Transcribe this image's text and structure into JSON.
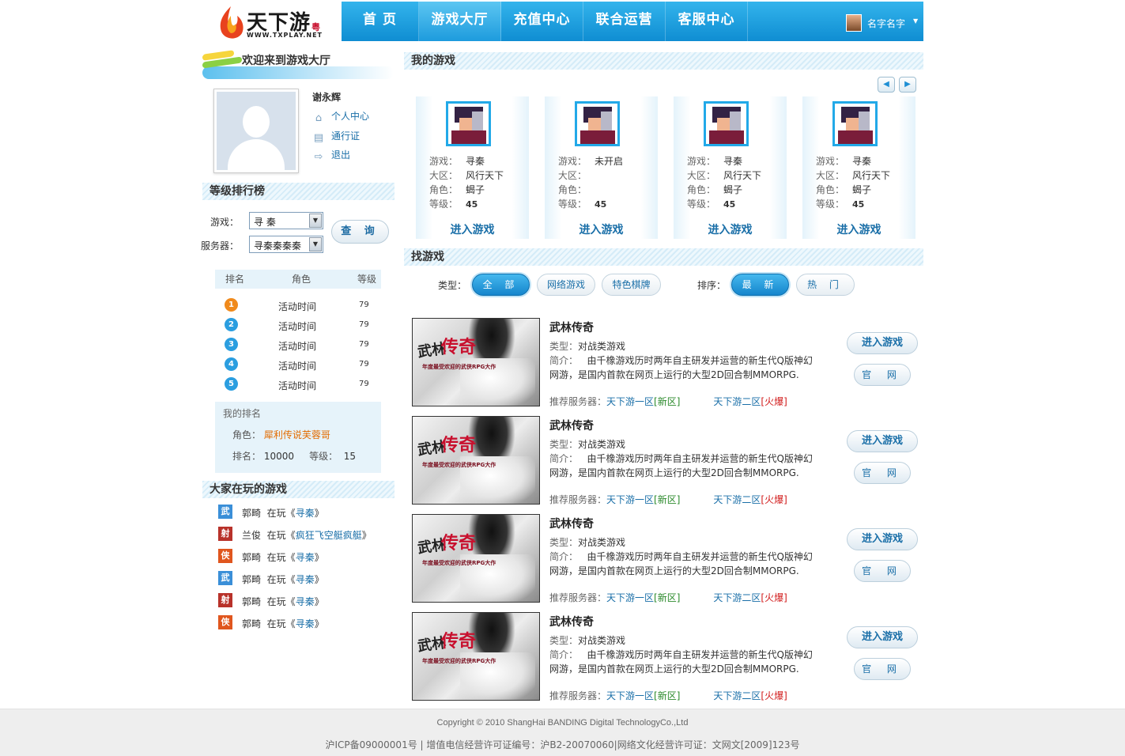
{
  "logo": {
    "text": "天下游",
    "sub": "WWW.TXPLAY.NET",
    "badge": "粤"
  },
  "nav": {
    "items": [
      {
        "label": "首 页"
      },
      {
        "label": "游戏大厅"
      },
      {
        "label": "充值中心"
      },
      {
        "label": "联合运营"
      },
      {
        "label": "客服中心"
      }
    ],
    "active_index": 1,
    "user_name": "名字名字"
  },
  "sidebar": {
    "welcome": "欢迎来到游戏大厅",
    "user": {
      "name": "谢永辉",
      "links": [
        {
          "label": "个人中心",
          "icon": "home-icon"
        },
        {
          "label": "通行证",
          "icon": "id-card-icon"
        },
        {
          "label": "退出",
          "icon": "logout-icon"
        }
      ]
    },
    "ranking": {
      "title": "等级排行榜",
      "game_label": "游戏：",
      "game_value": "寻 秦",
      "server_label": "服务器：",
      "server_value": "寻秦秦秦秦",
      "query_label": "查 询",
      "columns": [
        "排名",
        "角色",
        "等级"
      ],
      "rows": [
        {
          "rank": "1",
          "role": "活动时间",
          "level": "79"
        },
        {
          "rank": "2",
          "role": "活动时间",
          "level": "79"
        },
        {
          "rank": "3",
          "role": "活动时间",
          "level": "79"
        },
        {
          "rank": "4",
          "role": "活动时间",
          "level": "79"
        },
        {
          "rank": "5",
          "role": "活动时间",
          "level": "79"
        }
      ],
      "my_rank": {
        "title": "我的排名",
        "role_label": "角色：",
        "role_value": "犀利传说芙蓉哥",
        "rank_label": "排名：",
        "rank_value": "10000",
        "level_label": "等级：",
        "level_value": "15"
      }
    },
    "playing": {
      "title": "大家在玩的游戏",
      "items": [
        {
          "icon": "武",
          "user": "郭畸",
          "verb": "在玩",
          "game": "寻秦",
          "color": "#3a8fd8"
        },
        {
          "icon": "射",
          "user": "兰俊",
          "verb": "在玩",
          "game": "疯狂飞空艇疯艇",
          "color": "#b8322a"
        },
        {
          "icon": "侠",
          "user": "郭畸",
          "verb": "在玩",
          "game": "寻秦",
          "color": "#e0561e"
        },
        {
          "icon": "武",
          "user": "郭畸",
          "verb": "在玩",
          "game": "寻秦",
          "color": "#3a8fd8"
        },
        {
          "icon": "射",
          "user": "郭畸",
          "verb": "在玩",
          "game": "寻秦",
          "color": "#b8322a"
        },
        {
          "icon": "侠",
          "user": "郭畸",
          "verb": "在玩",
          "game": "寻秦",
          "color": "#e0561e"
        }
      ]
    }
  },
  "my_games": {
    "title": "我的游戏",
    "labels": {
      "game": "游戏：",
      "zone": "大区：",
      "role": "角色：",
      "level": "等级："
    },
    "enter_label": "进入游戏",
    "cards": [
      {
        "game": "寻秦",
        "zone": "风行天下",
        "role": "蝎子",
        "level": "45"
      },
      {
        "game": "未开启",
        "zone": "",
        "role": "",
        "level": "45"
      },
      {
        "game": "寻秦",
        "zone": "风行天下",
        "role": "蝎子",
        "level": "45"
      },
      {
        "game": "寻秦",
        "zone": "风行天下",
        "role": "蝎子",
        "level": "45"
      }
    ]
  },
  "find_games": {
    "title": "找游戏",
    "type_label": "类型：",
    "types": [
      "全 部",
      "网络游戏",
      "特色棋牌"
    ],
    "sort_label": "排序：",
    "sorts": [
      "最 新",
      "热 门"
    ],
    "list_labels": {
      "type": "类型：",
      "desc": "简介：",
      "servers": "推荐服务器："
    },
    "enter_label": "进入游戏",
    "site_label": "官 网",
    "items": [
      {
        "title": "武林传奇",
        "type": "对战类游戏",
        "desc": "由千橡游戏历时两年自主研发并运营的新生代Q版神幻网游，是国内首款在网页上运行的大型2D回合制MMORPG.",
        "s1": "天下游一区",
        "s1tag": "[新区]",
        "s2": "天下游二区",
        "s2tag": "[火爆]"
      },
      {
        "title": "武林传奇",
        "type": "对战类游戏",
        "desc": "由千橡游戏历时两年自主研发并运营的新生代Q版神幻网游，是国内首款在网页上运行的大型2D回合制MMORPG.",
        "s1": "天下游一区",
        "s1tag": "[新区]",
        "s2": "天下游二区",
        "s2tag": "[火爆]"
      },
      {
        "title": "武林传奇",
        "type": "对战类游戏",
        "desc": "由千橡游戏历时两年自主研发并运营的新生代Q版神幻网游，是国内首款在网页上运行的大型2D回合制MMORPG.",
        "s1": "天下游一区",
        "s1tag": "[新区]",
        "s2": "天下游二区",
        "s2tag": "[火爆]"
      },
      {
        "title": "武林传奇",
        "type": "对战类游戏",
        "desc": "由千橡游戏历时两年自主研发并运营的新生代Q版神幻网游，是国内首款在网页上运行的大型2D回合制MMORPG.",
        "s1": "天下游一区",
        "s1tag": "[新区]",
        "s2": "天下游二区",
        "s2tag": "[火爆]"
      }
    ],
    "cover_text": {
      "a": "武林",
      "b": "传奇",
      "tag": "年度最受欢迎的武侠RPG大作"
    }
  },
  "footer": {
    "copyright": "Copyright © 2010 ShangHai BANDING Digital TechnologyCo.,Ltd",
    "license": "沪ICP备09000001号 | 增值电信经营许可证编号：沪B2-20070060|网络文化经营许可证：文网文[2009]123号"
  },
  "colors": {
    "nav_blue": "#1a9ddf",
    "link": "#1a6fa8",
    "accent_orange": "#e36c00"
  }
}
